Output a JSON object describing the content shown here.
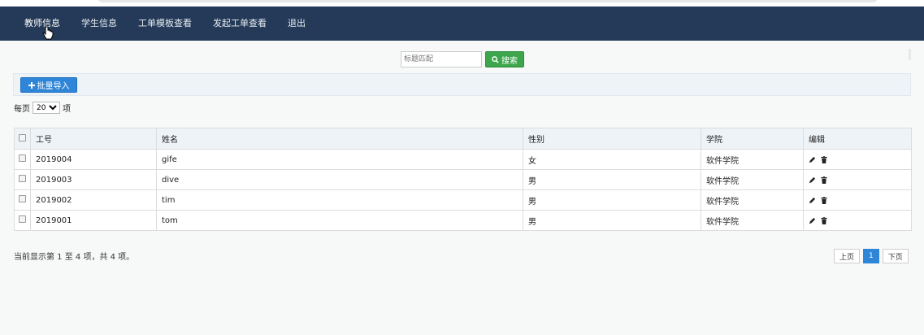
{
  "nav": {
    "items": [
      {
        "label": "教师信息"
      },
      {
        "label": "学生信息"
      },
      {
        "label": "工单模板查看"
      },
      {
        "label": "发起工单查看"
      },
      {
        "label": "退出"
      }
    ]
  },
  "search": {
    "placeholder": "标题匹配",
    "button_label": "搜索"
  },
  "toolbar": {
    "import_label": "批量导入"
  },
  "pagesize": {
    "prefix": "每页",
    "value": "20",
    "suffix": "项"
  },
  "table": {
    "headers": [
      "工号",
      "姓名",
      "性别",
      "学院",
      "编辑"
    ],
    "rows": [
      {
        "id": "2019004",
        "name": "gife",
        "gender": "女",
        "college": "软件学院"
      },
      {
        "id": "2019003",
        "name": "dive",
        "gender": "男",
        "college": "软件学院"
      },
      {
        "id": "2019002",
        "name": "tim",
        "gender": "男",
        "college": "软件学院"
      },
      {
        "id": "2019001",
        "name": "tom",
        "gender": "男",
        "college": "软件学院"
      }
    ]
  },
  "footer": {
    "summary": "当前显示第 1 至 4 项，共 4 项。",
    "prev": "上页",
    "current_page": "1",
    "next": "下页"
  },
  "colors": {
    "navbar": "#243a58",
    "search_button": "#3da64c",
    "primary_button": "#2f86d8"
  },
  "icons": {
    "search_button_icon": "search-icon",
    "import_icon": "plus-icon",
    "edit_icon": "pencil-icon",
    "delete_icon": "trash-icon"
  }
}
